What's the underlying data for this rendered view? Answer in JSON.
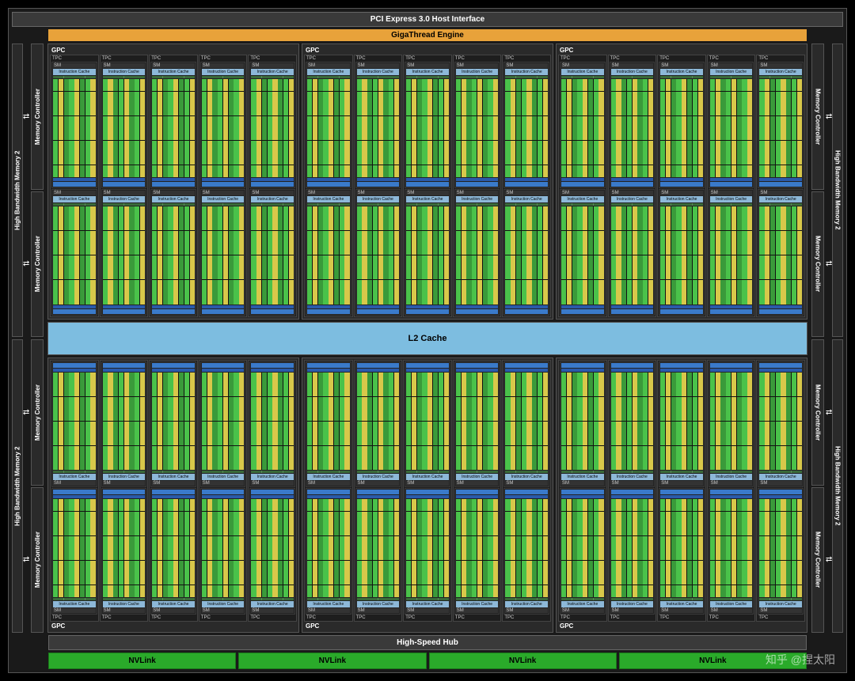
{
  "labels": {
    "host_interface": "PCI Express 3.0 Host Interface",
    "gigathread": "GigaThread Engine",
    "gpc": "GPC",
    "tpc": "TPC",
    "sm": "SM",
    "instruction_cache": "Instruction Cache",
    "l2_cache": "L2 Cache",
    "memory_controller": "Memory Controller",
    "hbm": "High Bandwidth Memory 2",
    "high_speed_hub": "High-Speed Hub",
    "nvlink": "NVLink"
  },
  "layout": {
    "gpc_rows": 2,
    "gpcs_per_row": 3,
    "tpcs_per_gpc": 5,
    "sms_per_tpc": 2,
    "total_sms": 60,
    "mem_controllers_per_side": 4,
    "hbm_per_side": 2,
    "nvlink_count": 4,
    "core_grid": {
      "cols": 8,
      "rows": 8
    }
  },
  "colors": {
    "gigathread": "#e8a23a",
    "l2": "#7dbde0",
    "icache": "#8db8d8",
    "nvlink": "#2aaa2a",
    "core_fp": "#4ac24a",
    "core_int": "#d8c84a",
    "register": "#2a5aaa",
    "shared_mem": "#3a7aca"
  },
  "watermark": "知乎 @捏太阳"
}
